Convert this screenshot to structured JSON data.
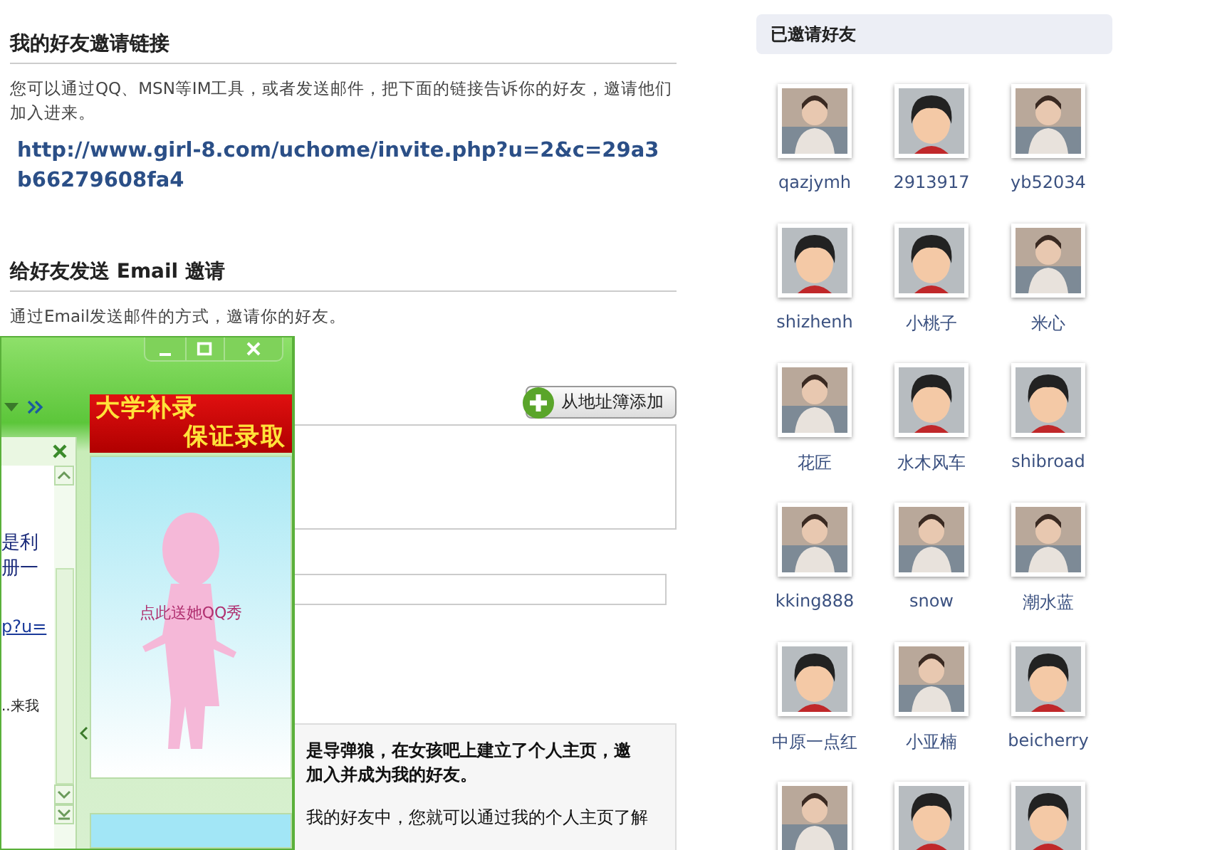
{
  "invite_link_section": {
    "heading": "我的好友邀请链接",
    "description": "您可以通过QQ、MSN等IM工具，或者发送邮件，把下面的链接告诉你的好友，邀请他们加入进来。",
    "link": "http://www.girl-8.com/uchome/invite.php?u=2&c=29a3b66279608fa4"
  },
  "email_section": {
    "heading": "给好友发送 Email 邀请",
    "description": "通过Email发送邮件的方式，邀请你的好友。",
    "address_book_button": "从地址簿添加",
    "message_lines": [
      "是导弹狼，在女孩吧上建立了个人主页，邀",
      "加入并成为我的好友。",
      "我的好友中，您就可以通过我的个人主页了解"
    ]
  },
  "invited_friends": {
    "heading": "已邀请好友",
    "friends": [
      {
        "name": "qazjymh",
        "kind": "picture"
      },
      {
        "name": "2913917",
        "kind": "default"
      },
      {
        "name": "yb52034",
        "kind": "picture"
      },
      {
        "name": "shizhenh",
        "kind": "default"
      },
      {
        "name": "小桃子",
        "kind": "default"
      },
      {
        "name": "米心",
        "kind": "picture"
      },
      {
        "name": "花匠",
        "kind": "picture"
      },
      {
        "name": "水木风车",
        "kind": "default"
      },
      {
        "name": "shibroad",
        "kind": "default"
      },
      {
        "name": "kking888",
        "kind": "picture"
      },
      {
        "name": "snow",
        "kind": "picture"
      },
      {
        "name": "潮水蓝",
        "kind": "picture"
      },
      {
        "name": "中原一点红",
        "kind": "default"
      },
      {
        "name": "小亚楠",
        "kind": "picture"
      },
      {
        "name": "beicherry",
        "kind": "default"
      },
      {
        "kind": "picture"
      },
      {
        "kind": "default"
      },
      {
        "kind": "default"
      }
    ]
  },
  "popup": {
    "chat_fragments": [
      {
        "kind": "text",
        "text": "是利"
      },
      {
        "kind": "text",
        "text": "册一"
      },
      {
        "kind": "link",
        "text": "p?u="
      },
      {
        "kind": "small",
        "text": "..来我"
      }
    ],
    "ad_banner_lines": [
      "大学补录",
      "保证录取"
    ],
    "show_caption": "点此送她QQ秀"
  }
}
